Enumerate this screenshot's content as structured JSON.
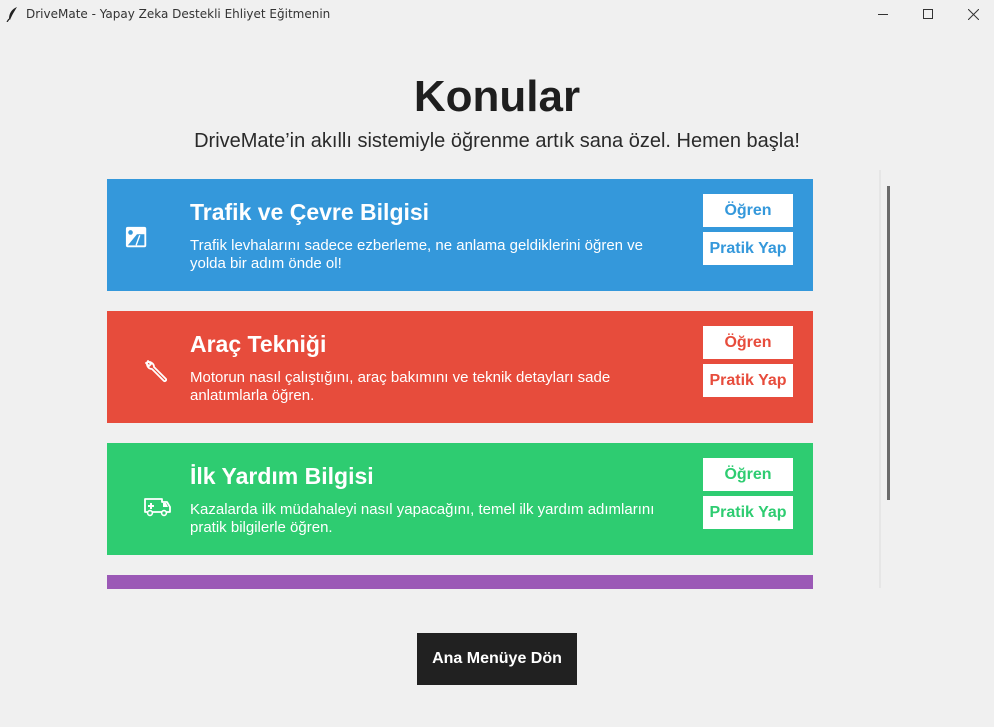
{
  "window": {
    "title": "DriveMate - Yapay Zeka Destekli Ehliyet Eğitmenin"
  },
  "page": {
    "heading": "Konular",
    "subtitle": "DriveMate’in akıllı sistemiyle öğrenme artık sana özel. Hemen başla!"
  },
  "topics": [
    {
      "title": "Trafik ve Çevre Bilgisi",
      "description": "Trafik levhalarını sadece ezberleme, ne anlama geldiklerini öğren ve yolda bir adım önde ol!",
      "learn_label": "Öğren",
      "practice_label": "Pratik Yap",
      "color": "#3498db",
      "icon": "road-sign-icon"
    },
    {
      "title": "Araç Tekniği",
      "description": "Motorun nasıl çalıştığını, araç bakımını ve teknik detayları sade anlatımlarla öğren.",
      "learn_label": "Öğren",
      "practice_label": "Pratik Yap",
      "color": "#e74c3c",
      "icon": "wrench-icon"
    },
    {
      "title": "İlk Yardım Bilgisi",
      "description": "Kazalarda ilk müdahaleyi nasıl yapacağını, temel ilk yardım adımlarını pratik bilgilerle öğren.",
      "learn_label": "Öğren",
      "practice_label": "Pratik Yap",
      "color": "#2ecc71",
      "icon": "ambulance-icon"
    },
    {
      "color": "#9b59b6"
    }
  ],
  "footer": {
    "back_label": "Ana Menüye Dön"
  }
}
